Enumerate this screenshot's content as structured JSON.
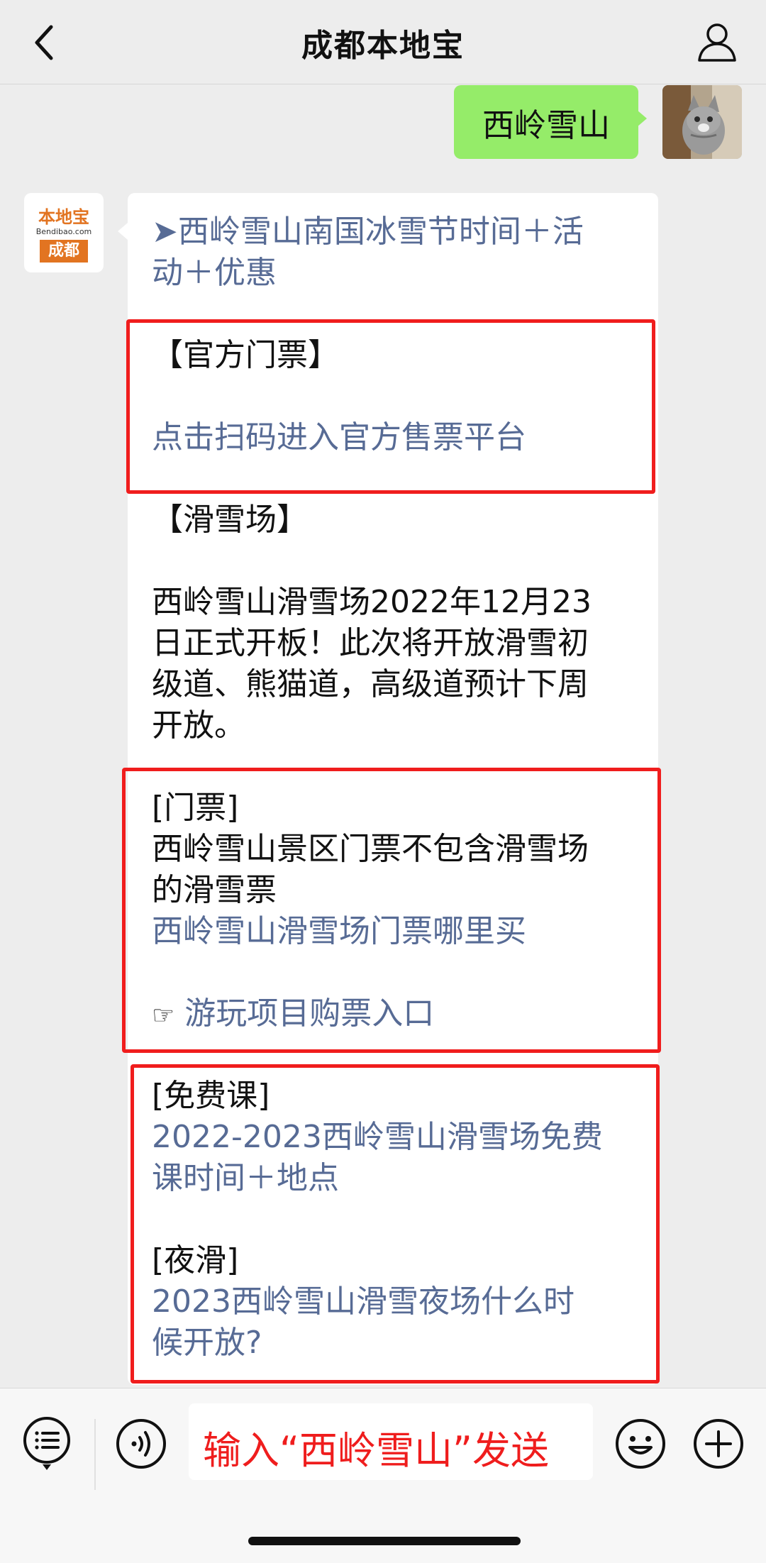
{
  "header": {
    "title": "成都本地宝",
    "back_icon": "chevron-left-icon",
    "profile_icon": "person-icon"
  },
  "outgoing": {
    "text": "西岭雪山"
  },
  "brand_avatar": {
    "line1": "本地宝",
    "line2": "Bendibao.com",
    "line3": "成都"
  },
  "reply": {
    "intro_link_line1": "➤西岭雪山南国冰雪节时间＋活",
    "intro_link_line2": "动＋优惠",
    "official_heading": "【官方门票】",
    "official_link": "点击扫码进入官方售票平台",
    "ski_heading": "【滑雪场】",
    "ski_body_line1": "西岭雪山滑雪场2022年12月23",
    "ski_body_line2": "日正式开板！此次将开放滑雪初",
    "ski_body_line3": "级道、熊猫道，高级道预计下周",
    "ski_body_line4": "开放。",
    "ticket_heading": "[门票]",
    "ticket_body_line1": "西岭雪山景区门票不包含滑雪场",
    "ticket_body_line2": "的滑雪票",
    "ticket_link": "西岭雪山滑雪场门票哪里买",
    "ticket_entry_icon": "☞",
    "ticket_entry_link": "游玩项目购票入口",
    "free_heading": "[免费课]",
    "free_link_line1": "2022-2023西岭雪山滑雪场免费",
    "free_link_line2": "课时间＋地点",
    "night_heading": "[夜滑]",
    "night_link_line1": "2023西岭雪山滑雪夜场什么时",
    "night_link_line2": "候开放?"
  },
  "bottom_bar": {
    "input_hint": "输入“西岭雪山”发送",
    "menu_icon": "menu-list-icon",
    "voice_icon": "voice-icon",
    "emoji_icon": "emoji-icon",
    "plus_icon": "plus-icon"
  },
  "colors": {
    "link": "#576b95",
    "highlight_box": "#f01d1d",
    "outgoing_bubble": "#95ec69",
    "background": "#ededed"
  }
}
